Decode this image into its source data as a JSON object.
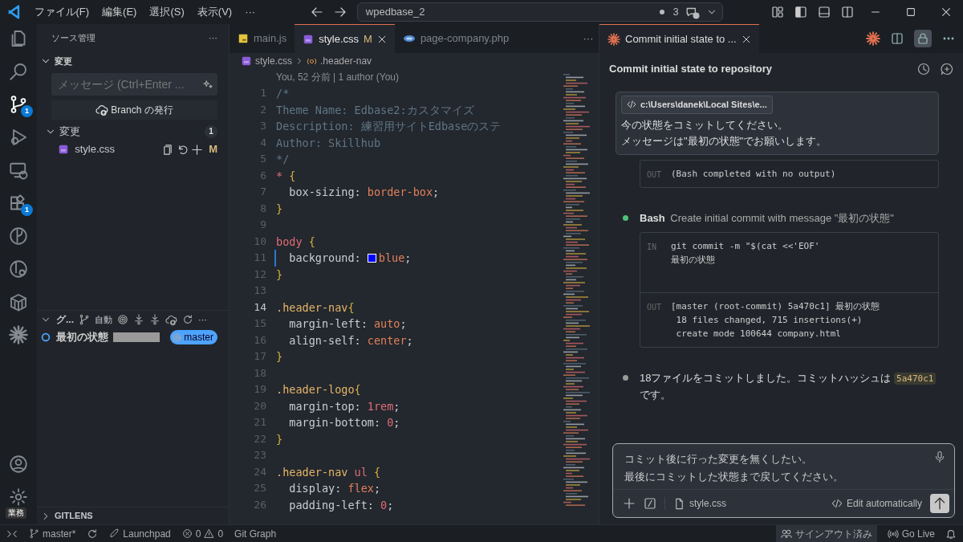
{
  "title_bar": {
    "menus": [
      "ファイル(F)",
      "編集(E)",
      "選択(S)",
      "表示(V)",
      "···"
    ],
    "command_center": {
      "text": "wpedbase_2",
      "count": "3"
    }
  },
  "activity_bar": {
    "items": [
      {
        "kind": "explorer",
        "selected": false
      },
      {
        "kind": "search",
        "selected": false
      },
      {
        "kind": "scm",
        "selected": true,
        "badge": "1"
      },
      {
        "kind": "debug",
        "selected": false
      },
      {
        "kind": "remote",
        "selected": false
      },
      {
        "kind": "extensions",
        "selected": false,
        "badge": "1"
      },
      {
        "kind": "gitlens",
        "selected": false
      },
      {
        "kind": "inspect",
        "selected": false
      },
      {
        "kind": "containers",
        "selected": false
      },
      {
        "kind": "claude",
        "selected": false
      }
    ],
    "bottom": [
      {
        "kind": "account"
      },
      {
        "kind": "settings",
        "label": "業務"
      }
    ]
  },
  "sidebar": {
    "title": "ソース管理",
    "more": "···",
    "section": {
      "title": "変更",
      "expanded": true
    },
    "message_field": {
      "placeholder": "メッセージ (Ctrl+Enter ..."
    },
    "publish_button": "Branch の発行",
    "changes": {
      "title": "変更",
      "expanded": true,
      "count": "1",
      "files": [
        {
          "name": "style.css",
          "status": "M"
        }
      ]
    },
    "graph": {
      "title": "グ...",
      "mode": "自動",
      "more": "···",
      "commits": [
        {
          "message": "最初の状態",
          "branch": "master"
        }
      ]
    },
    "gitlens": {
      "title": "GITLENS",
      "expanded": false
    }
  },
  "editor": {
    "tabs": [
      {
        "kind": "js",
        "label": "main.js",
        "selected": false
      },
      {
        "kind": "css",
        "label": "style.css",
        "status": "M",
        "selected": true
      },
      {
        "kind": "php",
        "label": "page-company.php",
        "selected": false
      }
    ],
    "more": "···",
    "breadcrumb": [
      "style.css",
      ".header-nav"
    ],
    "blame": "You, 52 分前 | 1 author (You)",
    "lines": [
      {
        "n": "1",
        "current": false,
        "modified": false,
        "tokens": [
          {
            "kind": "comment",
            "text": "/*"
          }
        ]
      },
      {
        "n": "2",
        "current": false,
        "modified": false,
        "tokens": [
          {
            "kind": "comment",
            "text": "Theme Name: Edbase2:カスタマイズ"
          }
        ]
      },
      {
        "n": "3",
        "current": false,
        "modified": false,
        "tokens": [
          {
            "kind": "comment",
            "text": "Description: 練習用サイトEdbaseのステ"
          }
        ]
      },
      {
        "n": "4",
        "current": false,
        "modified": false,
        "tokens": [
          {
            "kind": "comment",
            "text": "Author: Skillhub"
          }
        ]
      },
      {
        "n": "5",
        "current": false,
        "modified": false,
        "tokens": [
          {
            "kind": "comment",
            "text": "*/"
          }
        ]
      },
      {
        "n": "6",
        "current": false,
        "modified": false,
        "tokens": [
          {
            "kind": "selector",
            "text": "*"
          },
          {
            "kind": "brace",
            "text": " {"
          }
        ]
      },
      {
        "n": "7",
        "current": false,
        "modified": false,
        "tokens": [
          {
            "kind": "property",
            "text": "  box-sizing"
          },
          {
            "kind": "punct",
            "text": ": "
          },
          {
            "kind": "value",
            "text": "border-box"
          },
          {
            "kind": "punct",
            "text": ";"
          }
        ]
      },
      {
        "n": "8",
        "current": false,
        "modified": false,
        "tokens": [
          {
            "kind": "brace",
            "text": "}"
          }
        ]
      },
      {
        "n": "9",
        "current": false,
        "modified": false
      },
      {
        "n": "10",
        "current": false,
        "modified": false,
        "tokens": [
          {
            "kind": "selector",
            "text": "body"
          },
          {
            "kind": "brace",
            "text": " {"
          }
        ]
      },
      {
        "n": "11",
        "current": false,
        "modified": true,
        "tokens": [
          {
            "kind": "property",
            "text": "  background"
          },
          {
            "kind": "punct",
            "text": ": "
          },
          {
            "kind": "swatch",
            "color": "#0000ff"
          },
          {
            "kind": "value",
            "text": "blue"
          },
          {
            "kind": "punct",
            "text": ";"
          }
        ]
      },
      {
        "n": "12",
        "current": false,
        "modified": false,
        "tokens": [
          {
            "kind": "brace",
            "text": "}"
          }
        ]
      },
      {
        "n": "13",
        "current": false,
        "modified": false
      },
      {
        "n": "14",
        "current": true,
        "modified": false,
        "tokens": [
          {
            "kind": "class",
            "text": ".header-nav"
          },
          {
            "kind": "brace",
            "text": "{"
          }
        ]
      },
      {
        "n": "15",
        "current": false,
        "modified": false,
        "tokens": [
          {
            "kind": "property",
            "text": "  margin-left"
          },
          {
            "kind": "punct",
            "text": ": "
          },
          {
            "kind": "value",
            "text": "auto"
          },
          {
            "kind": "punct",
            "text": ";"
          }
        ]
      },
      {
        "n": "16",
        "current": false,
        "modified": false,
        "tokens": [
          {
            "kind": "property",
            "text": "  align-self"
          },
          {
            "kind": "punct",
            "text": ": "
          },
          {
            "kind": "value",
            "text": "center"
          },
          {
            "kind": "punct",
            "text": ";"
          }
        ]
      },
      {
        "n": "17",
        "current": false,
        "modified": false,
        "tokens": [
          {
            "kind": "brace",
            "text": "}"
          }
        ]
      },
      {
        "n": "18",
        "current": false,
        "modified": false
      },
      {
        "n": "19",
        "current": false,
        "modified": false,
        "tokens": [
          {
            "kind": "class",
            "text": ".header-logo"
          },
          {
            "kind": "brace",
            "text": "{"
          }
        ]
      },
      {
        "n": "20",
        "current": false,
        "modified": false,
        "tokens": [
          {
            "kind": "property",
            "text": "  margin-top"
          },
          {
            "kind": "punct",
            "text": ": "
          },
          {
            "kind": "number",
            "text": "1rem"
          },
          {
            "kind": "punct",
            "text": ";"
          }
        ]
      },
      {
        "n": "21",
        "current": false,
        "modified": false,
        "tokens": [
          {
            "kind": "property",
            "text": "  margin-bottom"
          },
          {
            "kind": "punct",
            "text": ": "
          },
          {
            "kind": "number",
            "text": "0"
          },
          {
            "kind": "punct",
            "text": ";"
          }
        ]
      },
      {
        "n": "22",
        "current": false,
        "modified": false,
        "tokens": [
          {
            "kind": "brace",
            "text": "}"
          }
        ]
      },
      {
        "n": "23",
        "current": false,
        "modified": false
      },
      {
        "n": "24",
        "current": false,
        "modified": false,
        "tokens": [
          {
            "kind": "class",
            "text": ".header-nav"
          },
          {
            "kind": "selector",
            "text": " ul"
          },
          {
            "kind": "brace",
            "text": " {"
          }
        ]
      },
      {
        "n": "25",
        "current": false,
        "modified": false,
        "tokens": [
          {
            "kind": "property",
            "text": "  display"
          },
          {
            "kind": "punct",
            "text": ": "
          },
          {
            "kind": "value",
            "text": "flex"
          },
          {
            "kind": "punct",
            "text": ";"
          }
        ]
      },
      {
        "n": "26",
        "current": false,
        "modified": false,
        "tokens": [
          {
            "kind": "property",
            "text": "  padding-left"
          },
          {
            "kind": "punct",
            "text": ": "
          },
          {
            "kind": "number",
            "text": "0"
          },
          {
            "kind": "punct",
            "text": ";"
          }
        ]
      }
    ]
  },
  "chat": {
    "tab": {
      "label": "Commit initial state to ..."
    },
    "title": "Commit initial state to repository",
    "messages": [
      {
        "kind": "user",
        "file": "c:\\Users\\danek\\Local Sites\\e...",
        "text": [
          "今の状態をコミットしてください。",
          "メッセージは\"最初の状態\"でお願いします。"
        ]
      },
      {
        "kind": "output",
        "rows": [
          {
            "label": "OUT",
            "lines": [
              "(Bash completed with no output)"
            ]
          }
        ]
      },
      {
        "kind": "tool",
        "color": "#4ec07a",
        "name": "Bash",
        "description": "Create initial commit with message \"最初の状態\"",
        "rows": [
          {
            "label": "IN",
            "lines": [
              "git commit -m \"$(cat <<'EOF'",
              "最初の状態"
            ]
          },
          {
            "label": "OUT",
            "lines": [
              "[master (root-commit) 5a470c1] 最初の状態",
              " 18 files changed, 715 insertions(+)",
              " create mode 100644 company.html"
            ]
          }
        ]
      },
      {
        "kind": "text",
        "color": "#9a9a9a",
        "before": "18ファイルをコミットしました。コミットハッシュは",
        "code": "5a470c1",
        "after": "です。"
      }
    ],
    "input": {
      "value": [
        "コミット後に行った変更を無くしたい。",
        "最後にコミットした状態まで戻してください。"
      ],
      "file": "style.css",
      "mode": "Edit automatically"
    }
  },
  "status_bar": {
    "items": [
      {
        "kind": "remote"
      },
      {
        "kind": "branch",
        "text": "master*"
      },
      {
        "kind": "sync"
      },
      {
        "kind": "launchpad",
        "text": "Launchpad"
      },
      {
        "kind": "problems",
        "errors": "0",
        "warnings": "0"
      },
      {
        "kind": "plain",
        "text": "Git Graph"
      }
    ],
    "right": [
      {
        "kind": "accounts",
        "text": "サインアウト済み"
      },
      {
        "kind": "live",
        "text": "Go Live"
      },
      {
        "kind": "bell"
      }
    ]
  }
}
